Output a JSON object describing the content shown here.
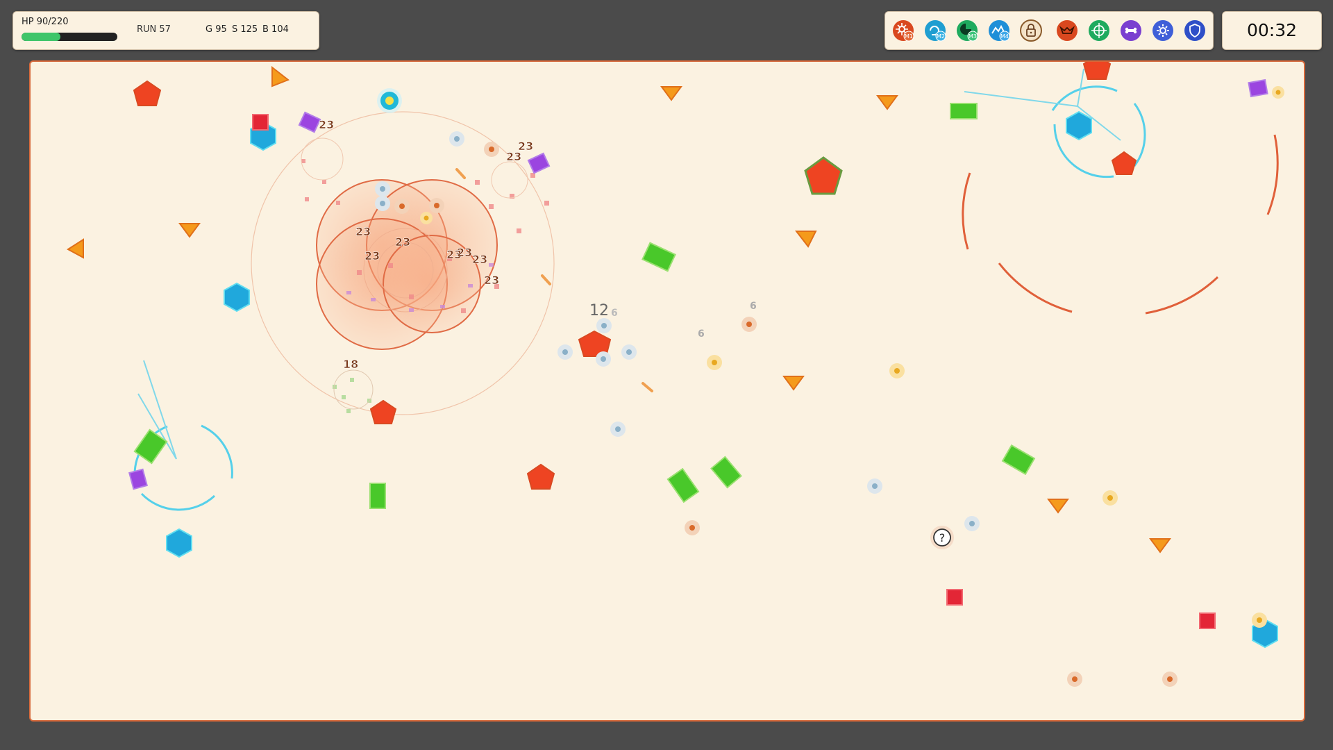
{
  "hud": {
    "hp_label": "HP 90/220",
    "hp_fraction": 0.409,
    "hp_color": "#3fc56a",
    "run_label": "RUN 57",
    "g_label": "G 95",
    "s_label": "S 125",
    "b_label": "B 104"
  },
  "timer": "00:32",
  "abilities": [
    {
      "name": "burst",
      "icon": "sunburst-icon",
      "color": "#d9481f",
      "badge": "M1"
    },
    {
      "name": "dash",
      "icon": "swirl-icon",
      "color": "#1f9ed1",
      "badge": "M2"
    },
    {
      "name": "radar",
      "icon": "radar-icon",
      "color": "#1faa5e",
      "badge": "M3"
    },
    {
      "name": "wave",
      "icon": "mountain-icon",
      "color": "#1f8fd8",
      "badge": "M4"
    },
    {
      "name": "locked",
      "icon": "lock-icon",
      "color": "#f4e3c8",
      "badge": ""
    },
    {
      "name": "crest",
      "icon": "wings-icon",
      "color": "#d9481f",
      "badge": ""
    },
    {
      "name": "target",
      "icon": "crosshair-icon",
      "color": "#1faa5e",
      "badge": ""
    },
    {
      "name": "bone",
      "icon": "bone-icon",
      "color": "#7a3fd0",
      "badge": ""
    },
    {
      "name": "gear",
      "icon": "gear-icon",
      "color": "#3f5fd8",
      "badge": ""
    },
    {
      "name": "shield",
      "icon": "shield-icon",
      "color": "#2f4fc8",
      "badge": ""
    }
  ],
  "damage_numbers": [
    "23",
    "23",
    "23",
    "23",
    "23",
    "23",
    "23",
    "23",
    "23",
    "23",
    "23",
    "18",
    "12",
    "6",
    "6",
    "6"
  ],
  "mystery_icon": "?",
  "colors": {
    "arena_bg": "#fbf2e1",
    "arena_border": "#d6683a",
    "enemy_red": "#ee4422",
    "enemy_blue": "#20a8dc",
    "enemy_green": "#49c82a",
    "enemy_orange": "#f59a1b",
    "enemy_purple": "#9b45e0",
    "enemy_crimson": "#e32636"
  }
}
